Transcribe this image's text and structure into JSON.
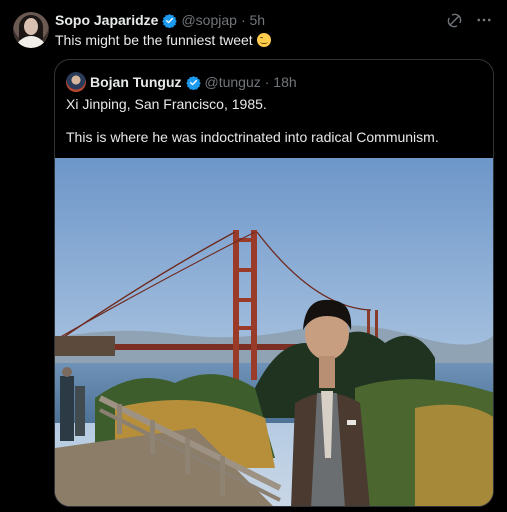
{
  "tweet": {
    "author_name": "Sopo Japaridze",
    "handle": "@sopjap",
    "time": "· 5h",
    "text": "This might be the funniest tweet",
    "emoji": "grinning-squinting-face"
  },
  "quoted": {
    "author_name": "Bojan Tunguz",
    "handle": "@tunguz",
    "time": "· 18h",
    "line1": "Xi Jinping, San Francisco, 1985.",
    "line2": "This is where he was indoctrinated into radical Communism."
  },
  "icons": {
    "verified": "verified-badge-icon",
    "grok": "grok-icon",
    "more": "more-options-icon"
  },
  "colors": {
    "background": "#000000",
    "text": "#e7e9ea",
    "muted": "#71767b",
    "verified": "#1d9bf0",
    "border": "#2f3336"
  }
}
